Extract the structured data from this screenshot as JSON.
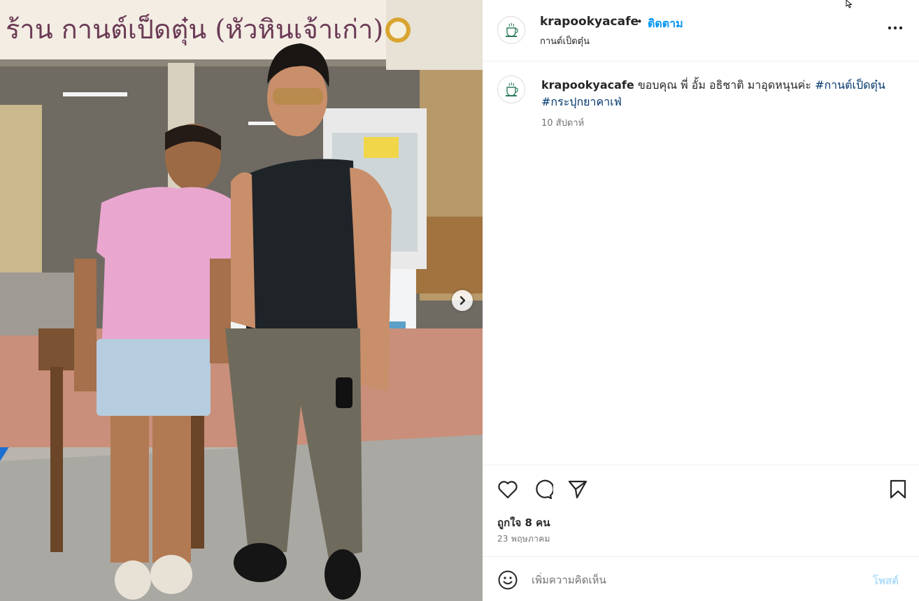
{
  "photo": {
    "sign_text": "ร้าน กานต์เป็ดตุ๋น (หัวหินเจ้าเก่า)",
    "nav_icon": "chevron-right-icon"
  },
  "header": {
    "username": "krapookyacafe",
    "separator": "•",
    "follow_label": "ติดตาม",
    "location": "กานต์เป็ดตุ๋น",
    "more_icon": "more-horizontal-icon"
  },
  "caption": {
    "username": "krapookyacafe",
    "text": " ขอบคุณ พี่ อั้ม อธิชาติ มาอุดหนุนค่ะ ",
    "hashtags": [
      "#กานต์เป็ดตุ๋น",
      "#กระปุกยาคาเฟ่"
    ],
    "time": "10 สัปดาห์"
  },
  "actions": {
    "icons": [
      "heart-icon",
      "comment-icon",
      "share-icon",
      "bookmark-icon"
    ],
    "likes": "ถูกใจ 8 คน",
    "date": "23 พฤษภาคม"
  },
  "comment": {
    "placeholder": "เพิ่มความคิดเห็น",
    "post_label": "โพสต์"
  },
  "colors": {
    "accent": "#0095f6",
    "hashtag": "#00376b",
    "muted": "#737373",
    "divider": "#efefef"
  }
}
